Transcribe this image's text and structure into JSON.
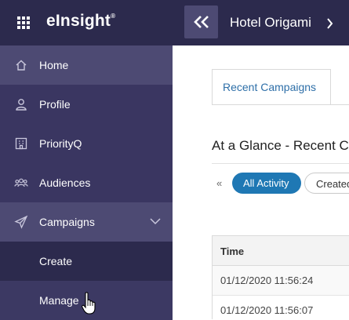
{
  "brand": {
    "name": "eInsight",
    "mark": "®"
  },
  "sidebar": {
    "items": [
      {
        "label": "Home",
        "icon": "home-icon"
      },
      {
        "label": "Profile",
        "icon": "user-icon"
      },
      {
        "label": "PriorityQ",
        "icon": "building-icon"
      },
      {
        "label": "Audiences",
        "icon": "people-icon"
      },
      {
        "label": "Campaigns",
        "icon": "paper-plane-icon",
        "expanded": true
      }
    ],
    "sub_items": [
      {
        "label": "Create"
      },
      {
        "label": "Manage"
      }
    ]
  },
  "topbar": {
    "hotel": "Hotel Origami"
  },
  "main": {
    "tabs": [
      {
        "label": "Recent Campaigns",
        "active": true
      }
    ],
    "section_title": "At a Glance - Recent C",
    "filters": {
      "prev_symbol": "«",
      "pills": [
        {
          "label": "All Activity",
          "active": true
        },
        {
          "label": "Created"
        }
      ]
    },
    "table": {
      "columns": [
        "Time"
      ],
      "rows": [
        [
          "01/12/2020 11:56:24"
        ],
        [
          "01/12/2020 11:56:07"
        ]
      ]
    }
  },
  "colors": {
    "sidebar": "#3a3661",
    "sidebar_dark": "#2c2a4d",
    "sidebar_active": "#4d4a73",
    "accent": "#1f78b4",
    "tab_text": "#2e6fa8"
  }
}
